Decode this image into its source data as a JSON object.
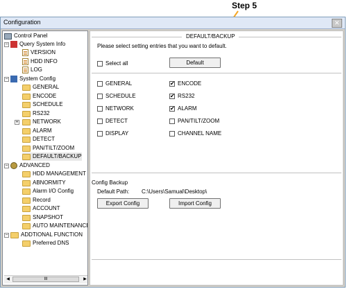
{
  "annotation": {
    "step_label": "Step 5"
  },
  "window": {
    "title": "Configuration",
    "close_glyph": "✕"
  },
  "tree": {
    "items": [
      {
        "label": "Control Panel"
      },
      {
        "label": "Query System Info"
      },
      {
        "label": "VERSION"
      },
      {
        "label": "HDD INFO"
      },
      {
        "label": "LOG"
      },
      {
        "label": "System Config"
      },
      {
        "label": "GENERAL"
      },
      {
        "label": "ENCODE"
      },
      {
        "label": "SCHEDULE"
      },
      {
        "label": "RS232"
      },
      {
        "label": "NETWORK"
      },
      {
        "label": "ALARM"
      },
      {
        "label": "DETECT"
      },
      {
        "label": "PAN/TILT/ZOOM"
      },
      {
        "label": "DEFAULT/BACKUP"
      },
      {
        "label": "ADVANCED"
      },
      {
        "label": "HDD MANAGEMENT"
      },
      {
        "label": "ABNORMITY"
      },
      {
        "label": "Alarm I/O Config"
      },
      {
        "label": "Record"
      },
      {
        "label": "ACCOUNT"
      },
      {
        "label": "SNAPSHOT"
      },
      {
        "label": "AUTO MAINTENANCE"
      },
      {
        "label": "ADDTIONAL FUNCTION"
      },
      {
        "label": "Preferred DNS"
      }
    ],
    "scroll_thumb": "III"
  },
  "panel": {
    "section_title": "DEFAULT/BACKUP",
    "instruction": "Please select setting entries that you want to default.",
    "select_all_label": "Select all",
    "select_all_checked": false,
    "default_button": "Default",
    "options": [
      {
        "label": "GENERAL",
        "checked": false
      },
      {
        "label": "ENCODE",
        "checked": true
      },
      {
        "label": "SCHEDULE",
        "checked": false
      },
      {
        "label": "RS232",
        "checked": true
      },
      {
        "label": "NETWORK",
        "checked": false
      },
      {
        "label": "ALARM",
        "checked": true
      },
      {
        "label": "DETECT",
        "checked": false
      },
      {
        "label": "PAN/TILT/ZOOM",
        "checked": false
      },
      {
        "label": "DISPLAY",
        "checked": false
      },
      {
        "label": "CHANNEL NAME",
        "checked": false
      }
    ],
    "config_backup": {
      "title": "Config Backup",
      "default_path_label": "Default Path:",
      "default_path_value": "C:\\Users\\Samual\\Desktop\\",
      "export_button": "Export Config",
      "import_button": "Import Config"
    }
  },
  "colors": {
    "arrow": "#f5a623",
    "folder": "#f4cf6b"
  }
}
